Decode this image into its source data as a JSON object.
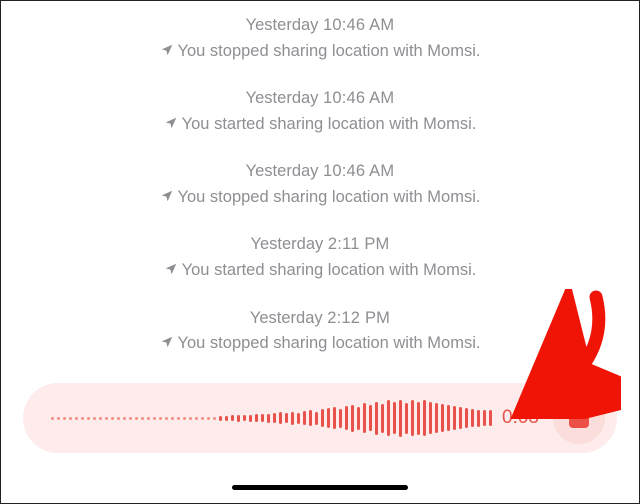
{
  "status_events": [
    {
      "day": "Yesterday",
      "time": "10:46 AM",
      "message": "You stopped sharing location with Momsi."
    },
    {
      "day": "Yesterday",
      "time": "10:46 AM",
      "message": "You started sharing location with Momsi."
    },
    {
      "day": "Yesterday",
      "time": "10:46 AM",
      "message": "You stopped sharing location with Momsi."
    },
    {
      "day": "Yesterday",
      "time": "2:11 PM",
      "message": "You started sharing location with Momsi."
    },
    {
      "day": "Yesterday",
      "time": "2:12 PM",
      "message": "You stopped sharing location with Momsi."
    }
  ],
  "recording": {
    "elapsed": "0:03",
    "waveform_heights": [
      3,
      3,
      3,
      3,
      3,
      3,
      3,
      3,
      3,
      3,
      3,
      3,
      3,
      3,
      3,
      3,
      3,
      3,
      3,
      3,
      3,
      3,
      3,
      3,
      3,
      3,
      3,
      4,
      5,
      5,
      6,
      7,
      6,
      7,
      8,
      8,
      9,
      10,
      12,
      10,
      13,
      11,
      14,
      16,
      13,
      18,
      20,
      22,
      19,
      24,
      27,
      23,
      30,
      26,
      33,
      29,
      36,
      32,
      37,
      31,
      36,
      33,
      36,
      32,
      30,
      28,
      26,
      24,
      22,
      20,
      18,
      17,
      16,
      16,
      15,
      15
    ]
  },
  "colors": {
    "muted_text": "#8e8e93",
    "pill_bg": "#fdeceb",
    "wave_strong": "#e7534a",
    "wave_soft": "#f28e88",
    "stop_btn_bg": "#fbdedc",
    "stop_square": "#ec4f45",
    "annotation_arrow": "#ef1406"
  }
}
